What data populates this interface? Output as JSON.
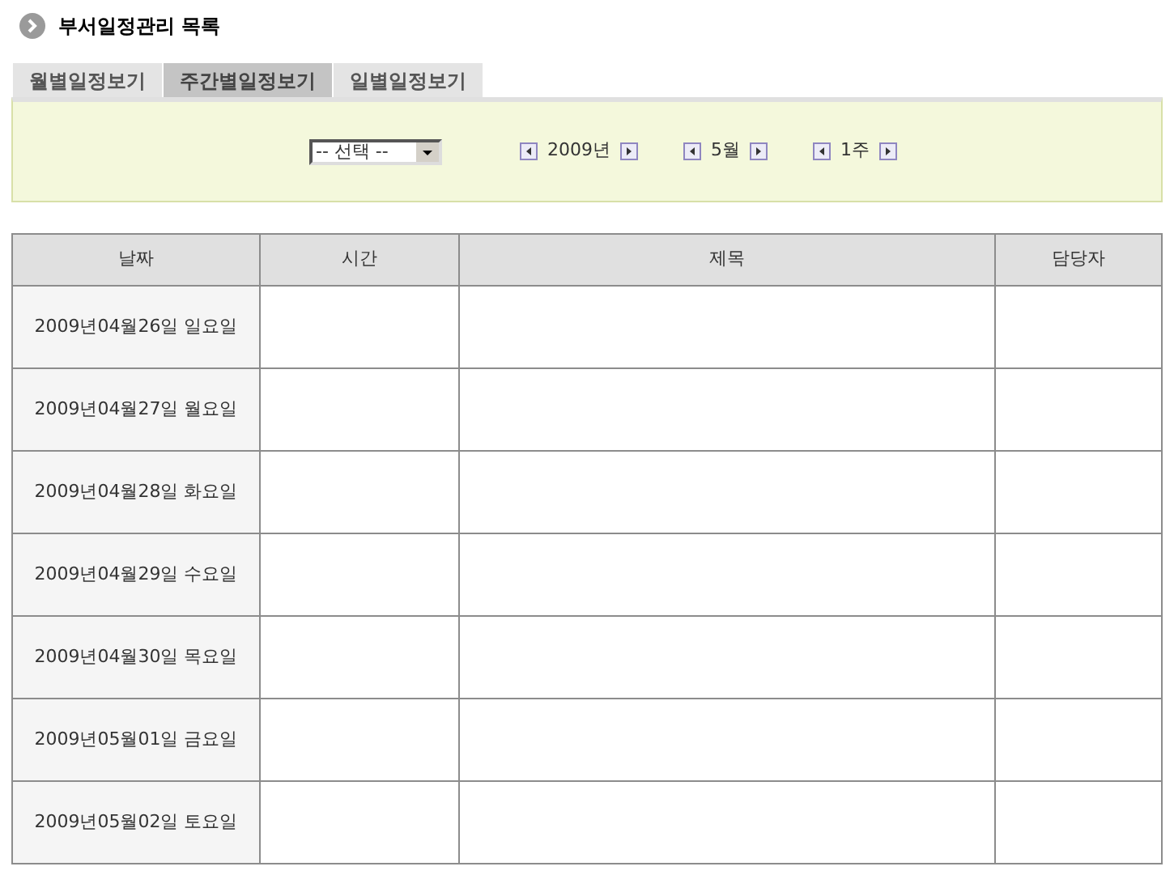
{
  "page_title": "부서일정관리 목록",
  "tabs": [
    {
      "label": "월별일정보기",
      "selected": false
    },
    {
      "label": "주간별일정보기",
      "selected": true
    },
    {
      "label": "일별일정보기",
      "selected": false
    }
  ],
  "filter": {
    "select": {
      "value": "-- 선택 --"
    },
    "steppers": [
      {
        "label": "2009년"
      },
      {
        "label": "5월"
      },
      {
        "label": "1주"
      }
    ]
  },
  "table": {
    "columns": [
      "날짜",
      "시간",
      "제목",
      "담당자"
    ],
    "rows": [
      {
        "date": "2009년04월26일 일요일"
      },
      {
        "date": "2009년04월27일 월요일"
      },
      {
        "date": "2009년04월28일 화요일"
      },
      {
        "date": "2009년04월29일 수요일"
      },
      {
        "date": "2009년04월30일 목요일"
      },
      {
        "date": "2009년05월01일 금요일"
      },
      {
        "date": "2009년05월02일 토요일"
      }
    ]
  }
}
